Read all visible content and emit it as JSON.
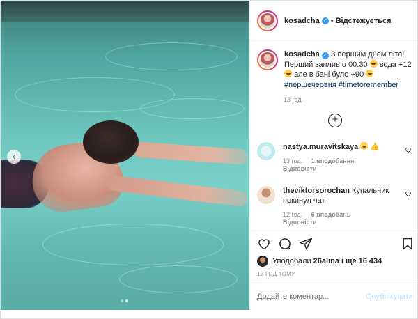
{
  "post": {
    "author": "kosadcha",
    "follow_label": "Відстежується",
    "separator": "•"
  },
  "caption": {
    "username": "kosadcha",
    "text_1": "З першим днем літа!",
    "text_2": "Перший заплив о 00:30",
    "text_3": "вода +12",
    "text_4": "але в бані було +90",
    "hashtag_1": "#першечервня",
    "hashtag_2": "#timetoremember",
    "time": "13 год."
  },
  "comments": [
    {
      "username": "nastya.muravitskaya",
      "text": "👍",
      "time": "13 год.",
      "likes": "1 вподобання",
      "reply": "Відповісти"
    },
    {
      "username": "theviktorsorochan",
      "text": "Купальник покинул чат",
      "time": "12 год.",
      "likes": "6 вподобань",
      "reply": "Відповісти"
    }
  ],
  "likes": {
    "prefix": "Уподобали",
    "liker": "26alina",
    "suffix": "і ще 16 434"
  },
  "timestamp": "13 ГОД ТОМУ",
  "comment_box": {
    "placeholder": "Додайте коментар...",
    "post_label": "Опублікувати"
  },
  "carousel": {
    "current": 2,
    "total": 2
  },
  "colors": {
    "link": "#00376b",
    "verified": "#3897f0",
    "post_disabled": "#b2dffc"
  }
}
